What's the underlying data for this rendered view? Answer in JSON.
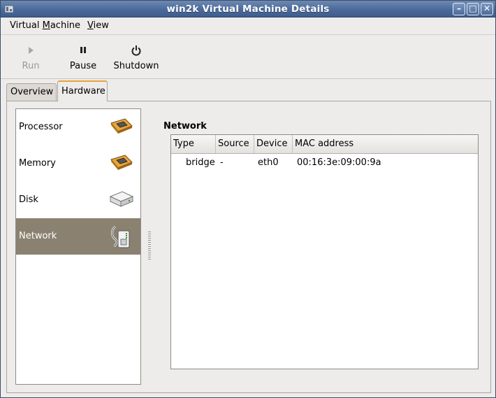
{
  "window": {
    "title": "win2k Virtual Machine Details"
  },
  "menubar": {
    "items": [
      {
        "label": "Virtual Machine",
        "mnemonic": "M"
      },
      {
        "label": "View",
        "mnemonic": "V"
      }
    ]
  },
  "toolbar": {
    "run_label": "Run",
    "pause_label": "Pause",
    "shutdown_label": "Shutdown"
  },
  "tabs": [
    {
      "label": "Overview",
      "selected": false
    },
    {
      "label": "Hardware",
      "selected": true
    }
  ],
  "hardware": {
    "items": [
      {
        "label": "Processor",
        "icon": "chip-icon",
        "selected": false
      },
      {
        "label": "Memory",
        "icon": "chip-icon",
        "selected": false
      },
      {
        "label": "Disk",
        "icon": "disk-icon",
        "selected": false
      },
      {
        "label": "Network",
        "icon": "network-icon",
        "selected": true
      }
    ]
  },
  "network": {
    "section_title": "Network",
    "columns": [
      "Type",
      "Source",
      "Device",
      "MAC address"
    ],
    "rows": [
      {
        "type": "bridge",
        "source": "-",
        "device": "eth0",
        "mac": "00:16:3e:09:00:9a"
      }
    ]
  },
  "colors": {
    "titlebar": "#4b6a9a",
    "selection": "#8a8171",
    "tab_accent": "#e5a33a"
  }
}
